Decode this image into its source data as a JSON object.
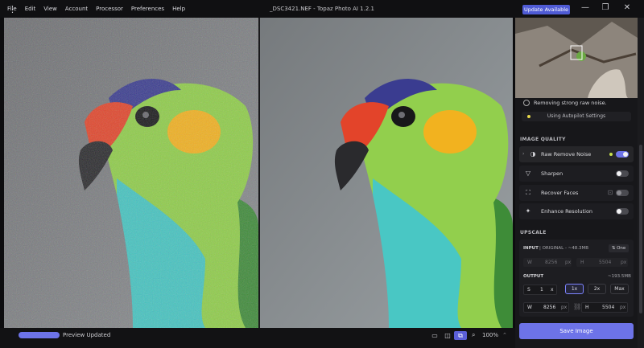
{
  "app": {
    "title": "_DSC3421.NEF - Topaz Photo AI 1.2.1",
    "menu": [
      "File",
      "Edit",
      "View",
      "Account",
      "Processor",
      "Preferences",
      "Help"
    ],
    "update_label": "Update Available",
    "accent_color": "#6d73e8"
  },
  "window_controls": [
    {
      "name": "minimize-icon",
      "glyph": "—"
    },
    {
      "name": "restore-icon",
      "glyph": "❐"
    },
    {
      "name": "close-icon",
      "glyph": "✕"
    }
  ],
  "bottombar": {
    "preview_status": "Preview Updated",
    "zoom": "100%",
    "view_modes": [
      {
        "name": "single-view-icon",
        "glyph": "▭"
      },
      {
        "name": "split-view-icon",
        "glyph": "◫"
      },
      {
        "name": "side-by-side-view-icon",
        "glyph": "⧉"
      }
    ]
  },
  "panel": {
    "status": "Removing strong raw noise.",
    "autopilot": "Using Autopilot Settings",
    "image_quality_heading": "IMAGE QUALITY",
    "filters": [
      {
        "label": "Raw Remove Noise",
        "icon": "noise-icon",
        "on": true
      },
      {
        "label": "Sharpen",
        "icon": "sharpen-icon",
        "on": false
      },
      {
        "label": "Recover Faces",
        "icon": "face-icon",
        "on": false
      },
      {
        "label": "Enhance Resolution",
        "icon": "enhance-icon",
        "on": false
      }
    ],
    "upscale_heading": "UPSCALE",
    "input": {
      "label": "INPUT",
      "subtitle": "| ORIGINAL - ~48.3MB",
      "one_button": "One",
      "w_label": "W",
      "w_value": "8256",
      "h_label": "H",
      "h_value": "5504",
      "unit": "px"
    },
    "output": {
      "label": "OUTPUT",
      "size": "~193.5MB",
      "s_label": "S",
      "scale": "1",
      "x": "x",
      "presets": [
        "1x",
        "2x",
        "Max"
      ],
      "w_label": "W",
      "w_value": "8256",
      "h_label": "H",
      "h_value": "5504",
      "unit": "px"
    },
    "save_label": "Save Image"
  }
}
